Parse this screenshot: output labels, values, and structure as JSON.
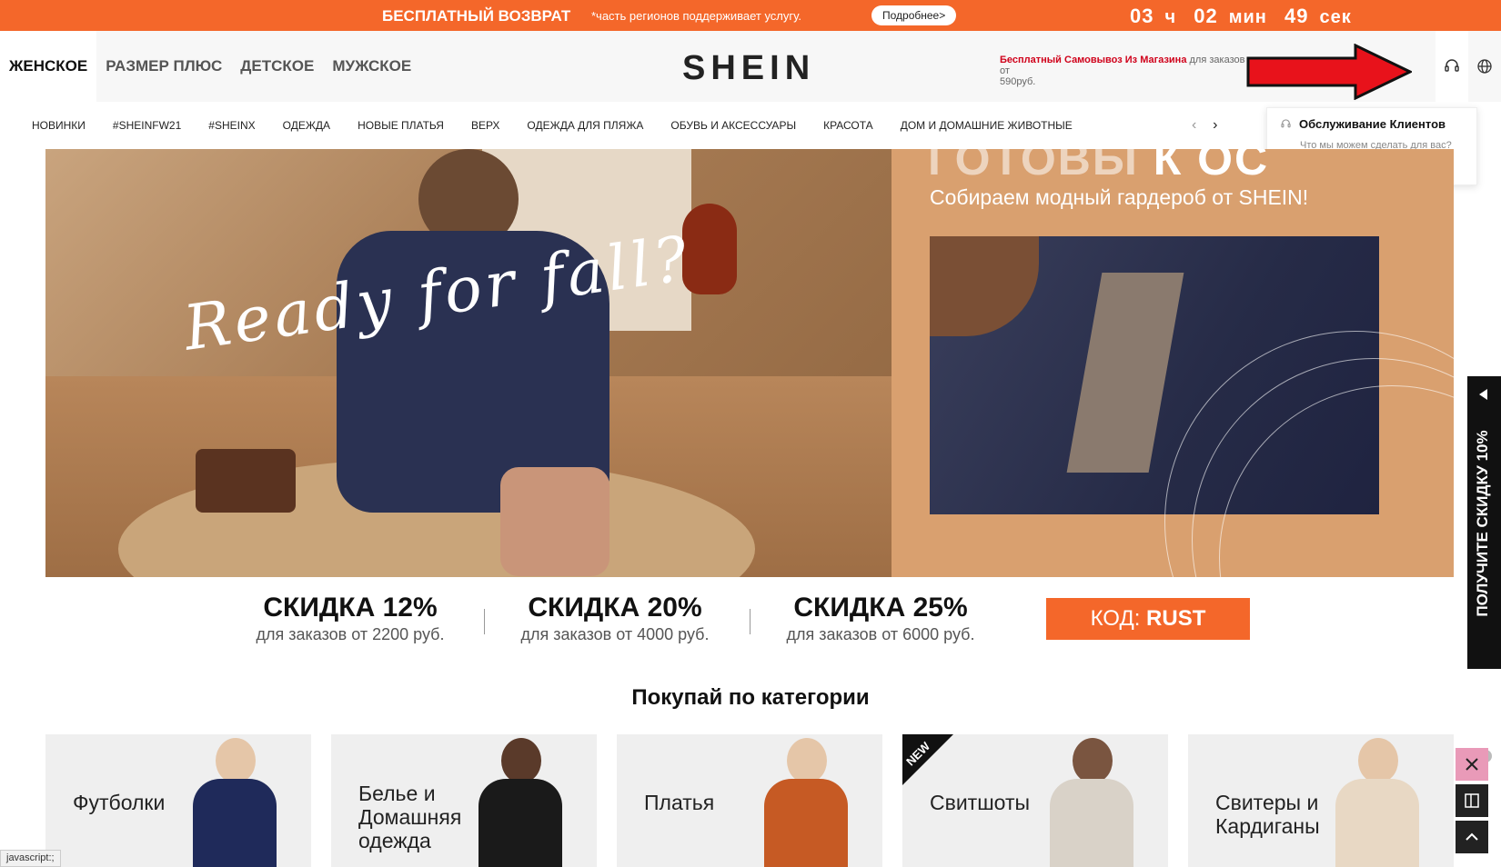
{
  "topbar": {
    "free_return": "БЕСПЛАТНЫЙ ВОЗВРАТ",
    "note": "*часть регионов поддерживает услугу.",
    "more_button": "Подробнее>",
    "timer": {
      "hours": "03",
      "h_unit": "ч",
      "minutes": "02",
      "m_unit": "мин",
      "seconds": "49",
      "s_unit": "сек"
    },
    "accent_color": "#f4672a"
  },
  "header": {
    "categories": [
      "ЖЕНСКОЕ",
      "РАЗМЕР ПЛЮС",
      "ДЕТСКОЕ",
      "МУЖСКОЕ"
    ],
    "logo": "SHEIN",
    "pickup_red": "Бесплатный Самовывоз Из Магазина",
    "pickup_rest": " для заказов от",
    "pickup_amount": "590руб.",
    "icons": [
      "headset-icon",
      "globe-icon"
    ]
  },
  "nav": {
    "items": [
      "НОВИНКИ",
      "#SHEINFW21",
      "#SHEINX",
      "ОДЕЖДА",
      "НОВЫЕ ПЛАТЬЯ",
      "ВЕРХ",
      "ОДЕЖДА ДЛЯ ПЛЯЖА",
      "ОБУВЬ И АКСЕССУАРЫ",
      "КРАСОТА",
      "ДОМ И ДОМАШНИЕ ЖИВОТНЫЕ"
    ],
    "prev": "‹",
    "next": "›"
  },
  "popup": {
    "title": "Обслуживание Клиентов",
    "subtitle": "Что мы можем сделать для вас?"
  },
  "banner": {
    "script_text": "Ready for fall?",
    "headline_ghost": "ГОТОВЫ",
    "headline_bold": "К ОС",
    "subtitle": "Собираем модный гардероб от SHEIN!"
  },
  "promo": {
    "deals": [
      {
        "title": "СКИДКА 12%",
        "condition": "для заказов от 2200 руб."
      },
      {
        "title": "СКИДКА 20%",
        "condition": "для заказов от 4000 руб."
      },
      {
        "title": "СКИДКА 25%",
        "condition": "для заказов от 6000 руб."
      }
    ],
    "code_label": "КОД: ",
    "code_value": "RUST"
  },
  "categories_section": {
    "title": "Покупай по категории",
    "cards": [
      {
        "label": "Футболки"
      },
      {
        "label": "Белье и Домашняя одежда"
      },
      {
        "label": "Платья"
      },
      {
        "label": "Свитшоты",
        "badge": "NEW"
      },
      {
        "label": "Свитеры и Кардиганы"
      }
    ]
  },
  "side_tab": {
    "text": "ПОЛУЧИТЕ СКИДКУ 10%"
  },
  "status_bar": "javascript:;"
}
